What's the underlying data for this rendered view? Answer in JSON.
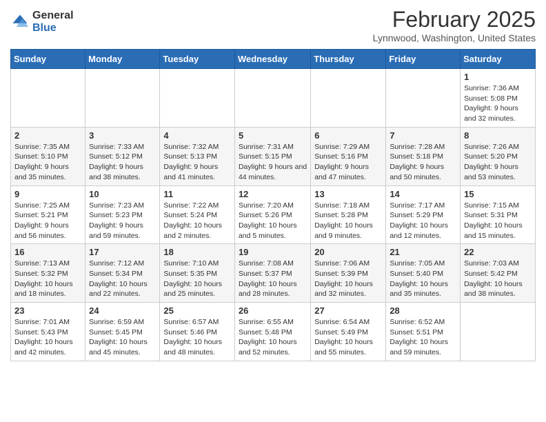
{
  "header": {
    "logo_general": "General",
    "logo_blue": "Blue",
    "month_title": "February 2025",
    "location": "Lynnwood, Washington, United States"
  },
  "days_of_week": [
    "Sunday",
    "Monday",
    "Tuesday",
    "Wednesday",
    "Thursday",
    "Friday",
    "Saturday"
  ],
  "weeks": [
    [
      {
        "day": "",
        "info": ""
      },
      {
        "day": "",
        "info": ""
      },
      {
        "day": "",
        "info": ""
      },
      {
        "day": "",
        "info": ""
      },
      {
        "day": "",
        "info": ""
      },
      {
        "day": "",
        "info": ""
      },
      {
        "day": "1",
        "info": "Sunrise: 7:36 AM\nSunset: 5:08 PM\nDaylight: 9 hours and 32 minutes."
      }
    ],
    [
      {
        "day": "2",
        "info": "Sunrise: 7:35 AM\nSunset: 5:10 PM\nDaylight: 9 hours and 35 minutes."
      },
      {
        "day": "3",
        "info": "Sunrise: 7:33 AM\nSunset: 5:12 PM\nDaylight: 9 hours and 38 minutes."
      },
      {
        "day": "4",
        "info": "Sunrise: 7:32 AM\nSunset: 5:13 PM\nDaylight: 9 hours and 41 minutes."
      },
      {
        "day": "5",
        "info": "Sunrise: 7:31 AM\nSunset: 5:15 PM\nDaylight: 9 hours and 44 minutes."
      },
      {
        "day": "6",
        "info": "Sunrise: 7:29 AM\nSunset: 5:16 PM\nDaylight: 9 hours and 47 minutes."
      },
      {
        "day": "7",
        "info": "Sunrise: 7:28 AM\nSunset: 5:18 PM\nDaylight: 9 hours and 50 minutes."
      },
      {
        "day": "8",
        "info": "Sunrise: 7:26 AM\nSunset: 5:20 PM\nDaylight: 9 hours and 53 minutes."
      }
    ],
    [
      {
        "day": "9",
        "info": "Sunrise: 7:25 AM\nSunset: 5:21 PM\nDaylight: 9 hours and 56 minutes."
      },
      {
        "day": "10",
        "info": "Sunrise: 7:23 AM\nSunset: 5:23 PM\nDaylight: 9 hours and 59 minutes."
      },
      {
        "day": "11",
        "info": "Sunrise: 7:22 AM\nSunset: 5:24 PM\nDaylight: 10 hours and 2 minutes."
      },
      {
        "day": "12",
        "info": "Sunrise: 7:20 AM\nSunset: 5:26 PM\nDaylight: 10 hours and 5 minutes."
      },
      {
        "day": "13",
        "info": "Sunrise: 7:18 AM\nSunset: 5:28 PM\nDaylight: 10 hours and 9 minutes."
      },
      {
        "day": "14",
        "info": "Sunrise: 7:17 AM\nSunset: 5:29 PM\nDaylight: 10 hours and 12 minutes."
      },
      {
        "day": "15",
        "info": "Sunrise: 7:15 AM\nSunset: 5:31 PM\nDaylight: 10 hours and 15 minutes."
      }
    ],
    [
      {
        "day": "16",
        "info": "Sunrise: 7:13 AM\nSunset: 5:32 PM\nDaylight: 10 hours and 18 minutes."
      },
      {
        "day": "17",
        "info": "Sunrise: 7:12 AM\nSunset: 5:34 PM\nDaylight: 10 hours and 22 minutes."
      },
      {
        "day": "18",
        "info": "Sunrise: 7:10 AM\nSunset: 5:35 PM\nDaylight: 10 hours and 25 minutes."
      },
      {
        "day": "19",
        "info": "Sunrise: 7:08 AM\nSunset: 5:37 PM\nDaylight: 10 hours and 28 minutes."
      },
      {
        "day": "20",
        "info": "Sunrise: 7:06 AM\nSunset: 5:39 PM\nDaylight: 10 hours and 32 minutes."
      },
      {
        "day": "21",
        "info": "Sunrise: 7:05 AM\nSunset: 5:40 PM\nDaylight: 10 hours and 35 minutes."
      },
      {
        "day": "22",
        "info": "Sunrise: 7:03 AM\nSunset: 5:42 PM\nDaylight: 10 hours and 38 minutes."
      }
    ],
    [
      {
        "day": "23",
        "info": "Sunrise: 7:01 AM\nSunset: 5:43 PM\nDaylight: 10 hours and 42 minutes."
      },
      {
        "day": "24",
        "info": "Sunrise: 6:59 AM\nSunset: 5:45 PM\nDaylight: 10 hours and 45 minutes."
      },
      {
        "day": "25",
        "info": "Sunrise: 6:57 AM\nSunset: 5:46 PM\nDaylight: 10 hours and 48 minutes."
      },
      {
        "day": "26",
        "info": "Sunrise: 6:55 AM\nSunset: 5:48 PM\nDaylight: 10 hours and 52 minutes."
      },
      {
        "day": "27",
        "info": "Sunrise: 6:54 AM\nSunset: 5:49 PM\nDaylight: 10 hours and 55 minutes."
      },
      {
        "day": "28",
        "info": "Sunrise: 6:52 AM\nSunset: 5:51 PM\nDaylight: 10 hours and 59 minutes."
      },
      {
        "day": "",
        "info": ""
      }
    ]
  ]
}
